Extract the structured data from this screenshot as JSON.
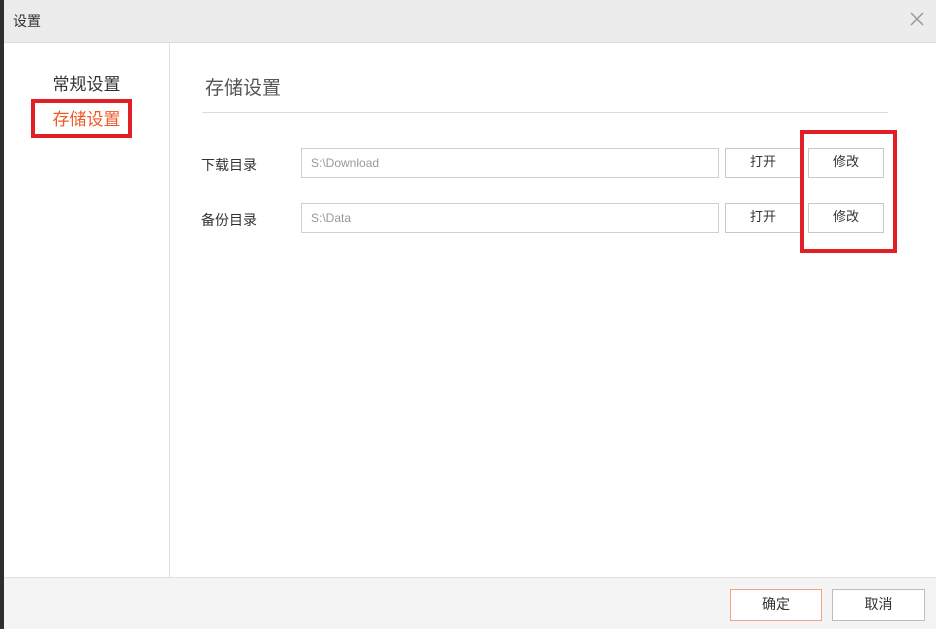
{
  "window": {
    "title": "设置",
    "close_icon": "close-icon"
  },
  "sidebar": {
    "items": [
      {
        "label": "常规设置",
        "selected": false
      },
      {
        "label": "存储设置",
        "selected": true
      }
    ]
  },
  "content": {
    "title": "存储设置",
    "rows": [
      {
        "label": "下载目录",
        "value": "S:\\Download",
        "open_label": "打开",
        "modify_label": "修改"
      },
      {
        "label": "备份目录",
        "value": "S:\\Data",
        "open_label": "打开",
        "modify_label": "修改"
      }
    ]
  },
  "footer": {
    "ok_label": "确定",
    "cancel_label": "取消"
  },
  "colors": {
    "accent": "#f05a28",
    "highlight": "#e01f26"
  }
}
